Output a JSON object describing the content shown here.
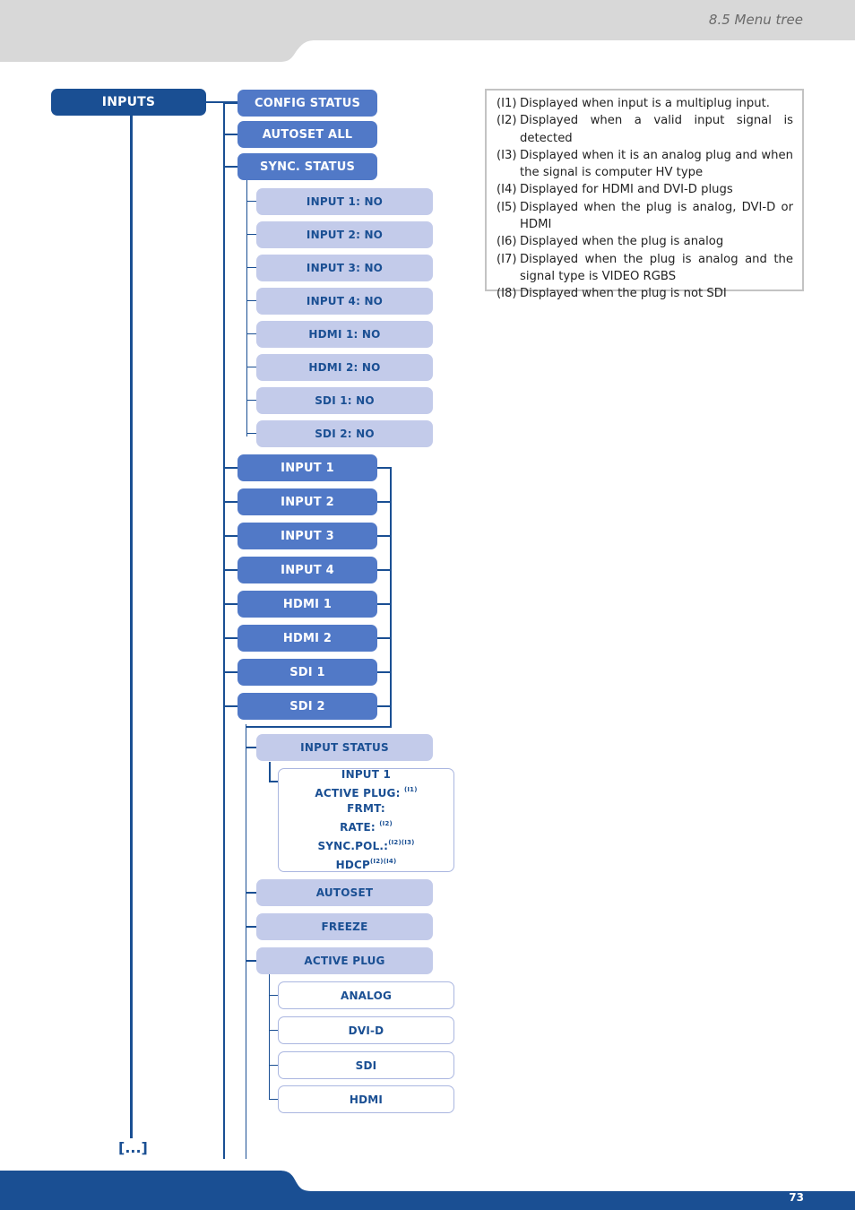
{
  "header": {
    "section_title": "8.5 Menu tree"
  },
  "footer": {
    "page_number": "73"
  },
  "colors": {
    "brand_dark": "#1a4f93",
    "level1": "#5179c7",
    "level2": "#c3cbea",
    "header_gray": "#d8d8d8"
  },
  "tree": {
    "root": "INPUTS",
    "continuation": "[...]",
    "level1_top": [
      "CONFIG STATUS",
      "AUTOSET ALL",
      "SYNC. STATUS"
    ],
    "sync_status_items": [
      "INPUT 1: NO",
      "INPUT 2: NO",
      "INPUT 3: NO",
      "INPUT 4: NO",
      "HDMI 1: NO",
      "HDMI 2: NO",
      "SDI 1: NO",
      "SDI 2: NO"
    ],
    "inputs": [
      "INPUT 1",
      "INPUT 2",
      "INPUT 3",
      "INPUT 4",
      "HDMI 1",
      "HDMI 2",
      "SDI 1",
      "SDI 2"
    ],
    "input_submenu": [
      "INPUT STATUS",
      "AUTOSET",
      "FREEZE",
      "ACTIVE PLUG"
    ],
    "input_status_lines": [
      {
        "text": "INPUT 1",
        "sup": ""
      },
      {
        "text": "ACTIVE PLUG: ",
        "sup": "(I1)"
      },
      {
        "text": "FRMT:",
        "sup": ""
      },
      {
        "text": "RATE: ",
        "sup": "(I2)"
      },
      {
        "text": "SYNC.POL.:",
        "sup": "(I2)(I3)"
      },
      {
        "text": "HDCP",
        "sup": "(I2)(I4)"
      }
    ],
    "active_plug_options": [
      "ANALOG",
      "DVI-D",
      "SDI",
      "HDMI"
    ]
  },
  "notes": [
    {
      "tag": "(I1)",
      "text": "Displayed when input is a multiplug input."
    },
    {
      "tag": "(I2)",
      "text": "Displayed when a valid input signal is detected"
    },
    {
      "tag": "(I3)",
      "text": "Displayed when it is an analog plug and when the signal is computer HV type"
    },
    {
      "tag": "(I4)",
      "text": "Displayed for HDMI and DVI-D plugs"
    },
    {
      "tag": "(I5)",
      "text": "Displayed when the plug is analog, DVI-D or HDMI"
    },
    {
      "tag": "(I6)",
      "text": "Displayed when the plug is analog"
    },
    {
      "tag": "(I7)",
      "text": "Displayed when the plug is analog and the signal type is VIDEO RGBS"
    },
    {
      "tag": "(I8)",
      "text": "Displayed when the plug is not SDI"
    }
  ]
}
